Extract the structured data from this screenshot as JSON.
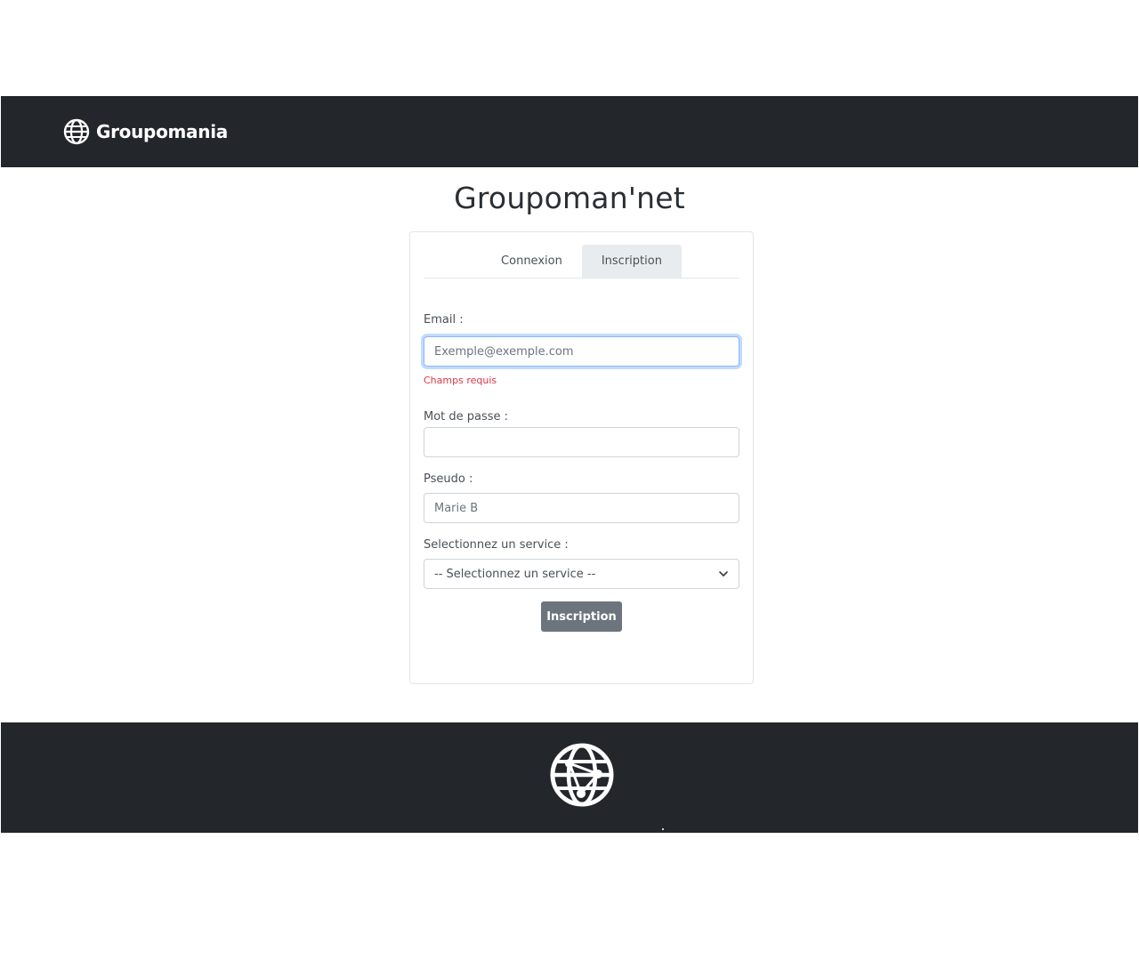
{
  "navbar": {
    "brand_name": "Groupomania",
    "brand_icon": "globe-icon"
  },
  "page": {
    "title": "Groupoman'net"
  },
  "tabs": [
    {
      "label": "Connexion",
      "active": false
    },
    {
      "label": "Inscription",
      "active": true
    }
  ],
  "form": {
    "email_label": "Email :",
    "email_placeholder": "Exemple@exemple.com",
    "email_value": "",
    "email_error": "Champs requis",
    "password_label": "Mot de passe :",
    "password_value": "",
    "pseudo_label": "Pseudo :",
    "pseudo_placeholder": "Marie B",
    "pseudo_value": "",
    "service_label": "Selectionnez un service :",
    "service_selected": "-- Selectionnez un service --",
    "submit_label": "Inscription"
  },
  "footer": {
    "icon": "globe-network-icon"
  },
  "colors": {
    "navbar_bg": "#23272b",
    "error": "#dc3545",
    "button_bg": "#6c757d",
    "active_tab_bg": "#e9ecef",
    "focus_border": "#86b7fe"
  }
}
